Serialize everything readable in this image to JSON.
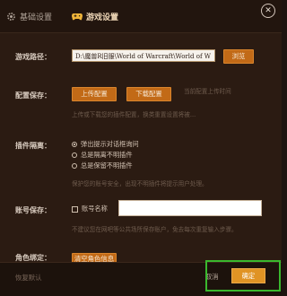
{
  "tabs": {
    "basic_label": "基础设置",
    "game_label": "游戏设置"
  },
  "colors": {
    "accent_button": "#c26a17",
    "confirm_button": "#e09324",
    "highlight_box": "#3ab82e",
    "background": "#2b1b12"
  },
  "game_path": {
    "label": "游戏路径：",
    "value": "D:\\魔兽R旧服\\World of Warcraft\\World of W",
    "browse_label": "浏览"
  },
  "config_save": {
    "label": "配置保存：",
    "upload_label": "上传配置",
    "download_label": "下载配置",
    "last_upload": "当前配置上传时间",
    "hint": "上传或下载您的插件配置，换类重置设置将被..."
  },
  "addon_isolation": {
    "label": "插件隔离：",
    "options": [
      "弹出提示对话框询问",
      "总是隔离不明插件",
      "总是保留不明插件"
    ],
    "selected_index": 0,
    "hint": "保护您的账号安全，出现不明插件将提示用户处理。"
  },
  "account_save": {
    "label": "账号保存：",
    "checkbox_label": "账号名称",
    "hint": "不建议您在网吧等公共场所保存账户，免去每次重复输入步骤。"
  },
  "role_binding": {
    "label": "角色绑定：",
    "clear_label": "清空角色信息"
  },
  "footer": {
    "reset_label": "恢复默认",
    "cancel_label": "取消",
    "confirm_label": "确定"
  }
}
